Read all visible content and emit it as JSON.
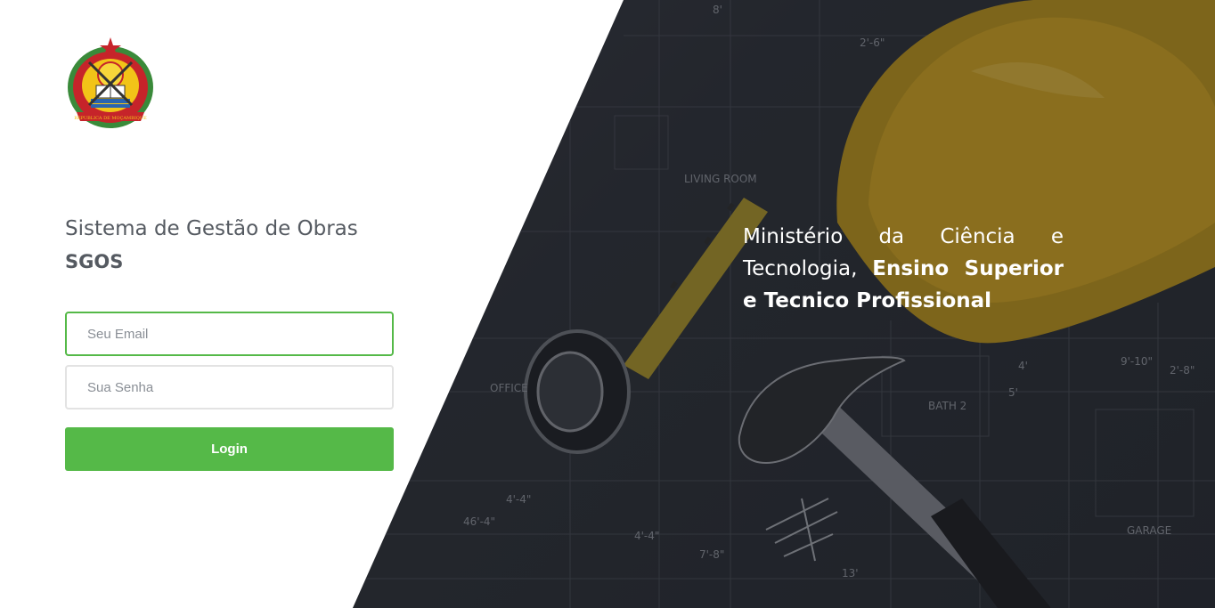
{
  "app": {
    "title": "Sistema de Gestão de Obras",
    "acronym": "SGOS"
  },
  "logo": {
    "icon": "mozambique-emblem-icon",
    "ribbon_text": "REPUBLICA DE MOÇAMBIQUE"
  },
  "form": {
    "email_placeholder": "Seu Email",
    "password_placeholder": "Sua Senha",
    "login_label": "Login"
  },
  "hero": {
    "text_light": "Ministério da Ciência e Tecnologia,",
    "text_bold": "Ensino Superior e Tecnico Profissional"
  },
  "colors": {
    "accent": "#55b948",
    "title_text": "#555a61",
    "hero_overlay": "#2c2f36",
    "helmet": "#d8a91e"
  }
}
